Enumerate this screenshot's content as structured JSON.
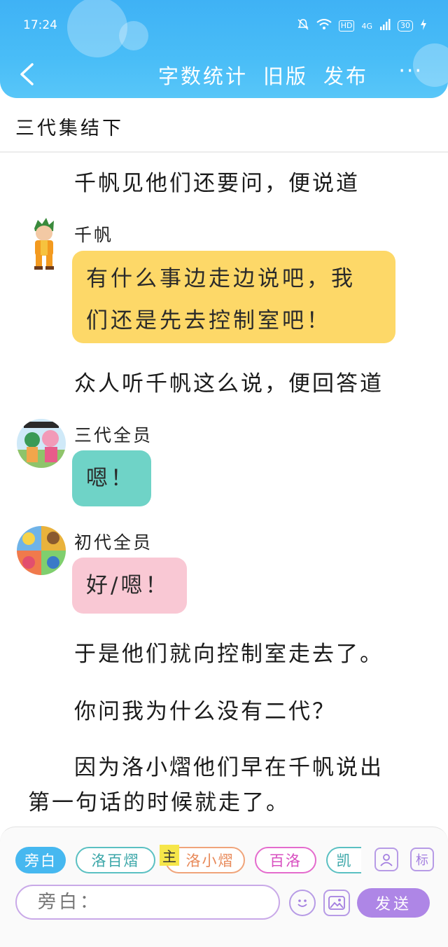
{
  "status_bar": {
    "time": "17:24",
    "hd": "HD",
    "network": "4G",
    "battery": "30"
  },
  "header": {
    "word_count": "字数统计",
    "old_version": "旧版",
    "publish": "发布",
    "more": "···"
  },
  "chapter": {
    "title": "三代集结下"
  },
  "story": {
    "narration_1": "千帆见他们还要问，便说道",
    "message_1": {
      "speaker": "千帆",
      "text_line1": "有什么事边走边说吧，我",
      "text_line2": "们还是先去控制室吧！",
      "color": "#fdd868"
    },
    "narration_2": "众人听千帆这么说，便回答道",
    "message_2": {
      "speaker": "三代全员",
      "text": "嗯！",
      "color": "#6fd3c7"
    },
    "message_3": {
      "speaker": "初代全员",
      "text": "好/嗯！",
      "color": "#f9c8d4"
    },
    "narration_3": "于是他们就向控制室走去了。",
    "narration_4": "你问我为什么没有二代？",
    "narration_5_line1": "因为洛小熠他们早在千帆说出",
    "narration_5_line2": "第一句话的时候就走了。"
  },
  "bottom_bar": {
    "chips": {
      "narrator": "旁白",
      "char1": "洛百熠",
      "main_tag": "主",
      "char2": "洛小熠",
      "char3": "百洛",
      "char4": "凯"
    },
    "tag_button": "标",
    "input_placeholder": "旁白：",
    "send": "发送"
  }
}
